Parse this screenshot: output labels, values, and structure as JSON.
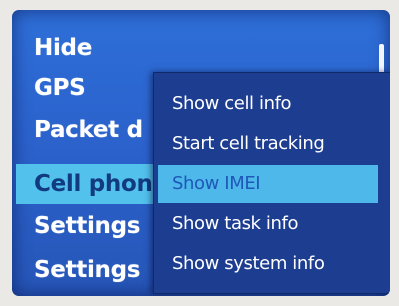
{
  "main_menu": {
    "items": [
      {
        "label": "Hide"
      },
      {
        "label": "GPS"
      },
      {
        "label": "Packet d"
      },
      {
        "label": "Cell phon"
      },
      {
        "label": "Settings"
      },
      {
        "label": "Settings"
      }
    ],
    "selected_index": 3
  },
  "popup_menu": {
    "items": [
      {
        "label": "Show cell info"
      },
      {
        "label": "Start cell tracking"
      },
      {
        "label": "Show IMEI"
      },
      {
        "label": "Show task info"
      },
      {
        "label": "Show system info"
      }
    ],
    "highlighted_index": 2
  },
  "colors": {
    "background": "#2b62cc",
    "selection": "#52c1ec",
    "popup": "#1d3d90",
    "text": "#ffffff"
  }
}
